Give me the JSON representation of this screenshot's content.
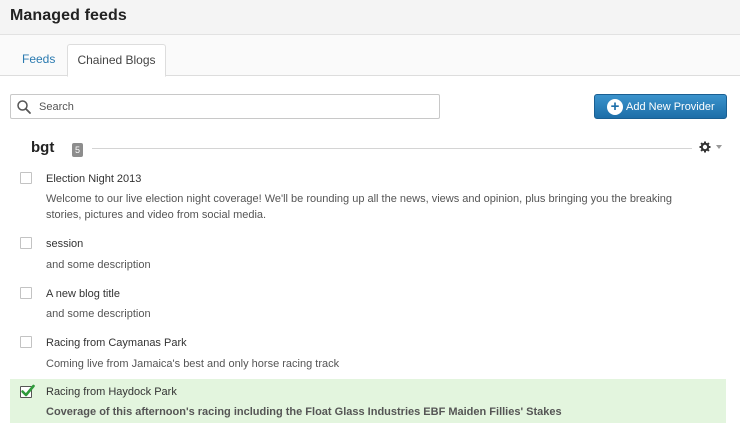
{
  "header": {
    "title": "Managed feeds"
  },
  "tabs": [
    {
      "label": "Feeds",
      "active": false
    },
    {
      "label": "Chained Blogs",
      "active": true
    }
  ],
  "search": {
    "placeholder": "Search",
    "value": ""
  },
  "toolbar": {
    "add_label": "Add New Provider"
  },
  "group": {
    "name": "bgt",
    "count": "5"
  },
  "items": [
    {
      "title": "Election Night 2013",
      "description": "Welcome to our live election night coverage! We'll be rounding up all the news, views and opinion, plus bringing you the breaking stories, pictures and video from social media.",
      "checked": false
    },
    {
      "title": "session",
      "description": "and some description",
      "checked": false
    },
    {
      "title": "A new blog title",
      "description": "and some description",
      "checked": false
    },
    {
      "title": "Racing from Caymanas Park",
      "description": "Coming live from Jamaica's best and only horse racing track",
      "checked": false
    },
    {
      "title": "Racing from Haydock Park",
      "description": "Coverage of this afternoon's racing including the Float Glass Industries EBF Maiden Fillies' Stakes",
      "checked": true
    }
  ],
  "colors": {
    "accent": "#1e70aa",
    "selected_bg": "#e3f5de",
    "check": "#2e9a3a"
  }
}
